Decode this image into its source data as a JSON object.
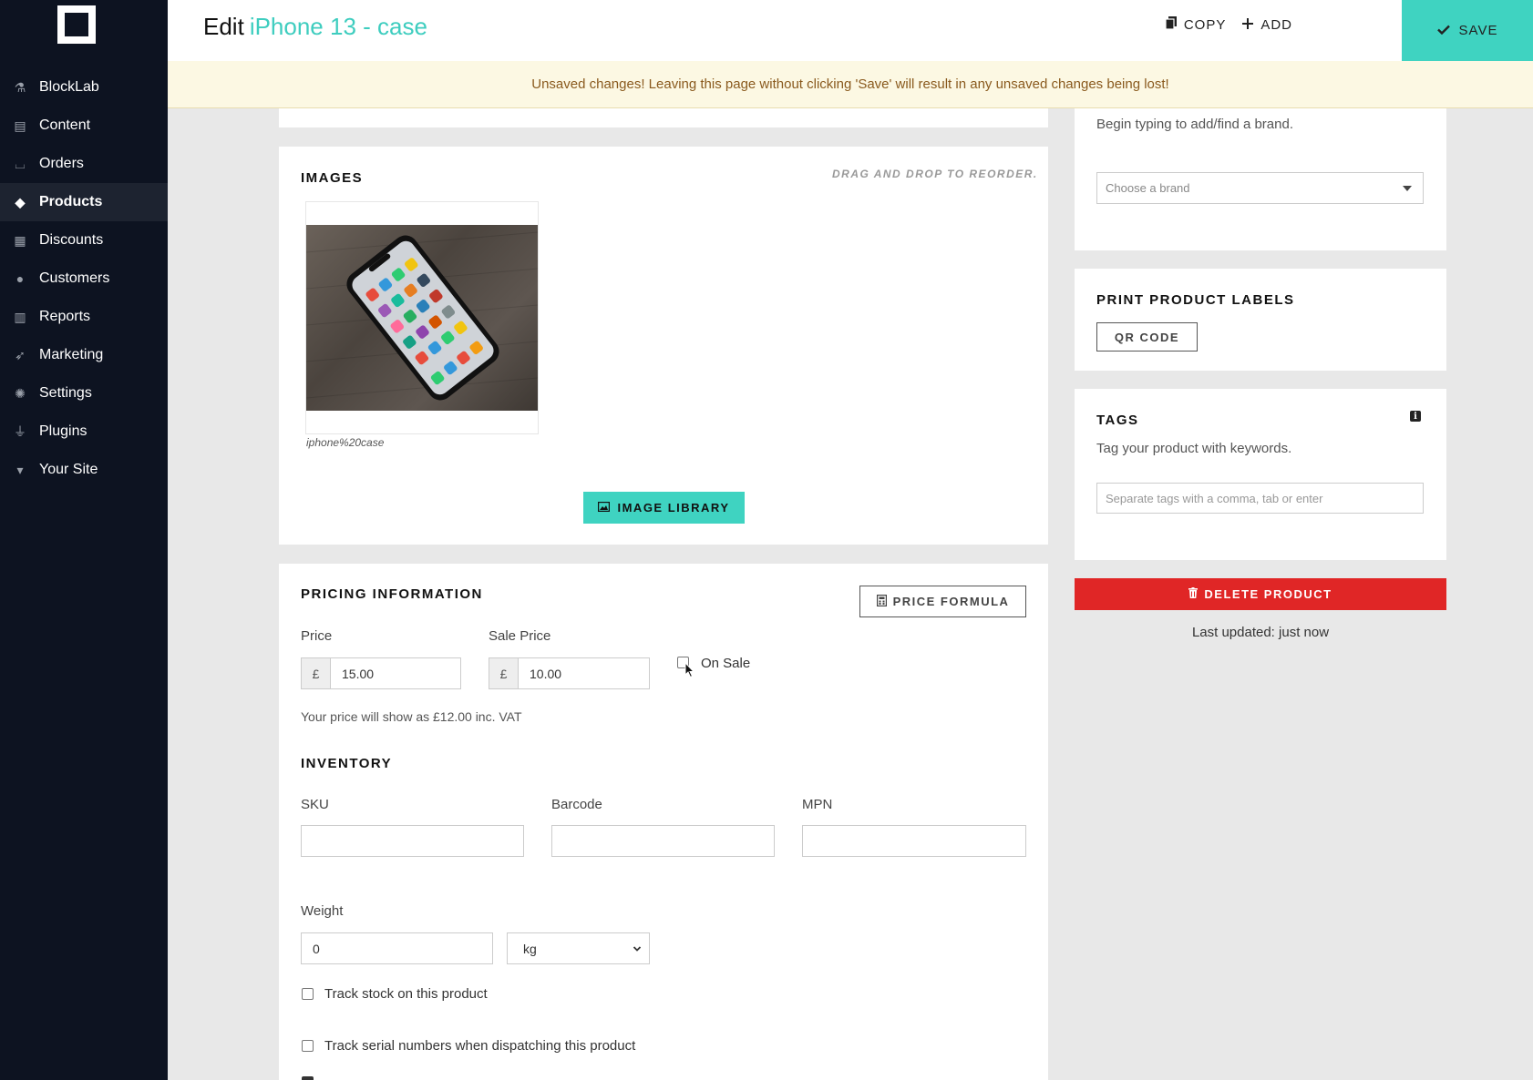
{
  "sidebar": {
    "items": [
      {
        "label": "BlockLab",
        "icon": "flask-icon",
        "glyph": "⚗"
      },
      {
        "label": "Content",
        "icon": "file-icon",
        "glyph": "▤"
      },
      {
        "label": "Orders",
        "icon": "inbox-icon",
        "glyph": "⌴"
      },
      {
        "label": "Products",
        "icon": "tag-icon",
        "glyph": "◆"
      },
      {
        "label": "Discounts",
        "icon": "calendar-icon",
        "glyph": "▦"
      },
      {
        "label": "Customers",
        "icon": "users-icon",
        "glyph": "●"
      },
      {
        "label": "Reports",
        "icon": "bar-chart-icon",
        "glyph": "▥"
      },
      {
        "label": "Marketing",
        "icon": "rocket-icon",
        "glyph": "➶"
      },
      {
        "label": "Settings",
        "icon": "gear-icon",
        "glyph": "✺"
      },
      {
        "label": "Plugins",
        "icon": "plug-icon",
        "glyph": "⏚"
      },
      {
        "label": "Your Site",
        "icon": "basket-icon",
        "glyph": "▾"
      }
    ],
    "active_index": 3
  },
  "header": {
    "edit_label": "Edit",
    "product_name": "iPhone 13 - case",
    "copy_label": "COPY",
    "add_label": "ADD",
    "save_label": "SAVE"
  },
  "warning": {
    "text": "Unsaved changes! Leaving this page without clicking 'Save' will result in any unsaved changes being lost!"
  },
  "images": {
    "title": "IMAGES",
    "reorder_note": "DRAG AND DROP TO REORDER.",
    "caption": "iphone%20case",
    "library_button": "IMAGE LIBRARY"
  },
  "pricing": {
    "title": "PRICING INFORMATION",
    "formula_button": "PRICE FORMULA",
    "price_label": "Price",
    "price_currency": "£",
    "price_value": "15.00",
    "sale_price_label": "Sale Price",
    "sale_currency": "£",
    "sale_value": "10.00",
    "on_sale_label": "On Sale",
    "on_sale_checked": false,
    "vat_note": "Your price will show as £12.00 inc. VAT"
  },
  "inventory": {
    "title": "INVENTORY",
    "sku_label": "SKU",
    "sku_value": "",
    "barcode_label": "Barcode",
    "barcode_value": "",
    "mpn_label": "MPN",
    "mpn_value": "",
    "weight_label": "Weight",
    "weight_value": "0",
    "weight_unit": "kg",
    "track_stock_label": "Track stock on this product",
    "track_serial_label": "Track serial numbers when dispatching this product"
  },
  "brand": {
    "hint": "Begin typing to add/find a brand.",
    "placeholder": "Choose a brand"
  },
  "labels": {
    "title": "PRINT PRODUCT LABELS",
    "qr_button": "QR CODE"
  },
  "tags": {
    "title": "TAGS",
    "hint": "Tag your product with keywords.",
    "placeholder": "Separate tags with a comma, tab or enter"
  },
  "delete_button": "DELETE PRODUCT",
  "last_updated": "Last updated: just now",
  "colors": {
    "accent": "#3fd3c1",
    "sidebar": "#0d1321",
    "danger": "#e02626",
    "warning_bg": "#fcf8e3"
  }
}
